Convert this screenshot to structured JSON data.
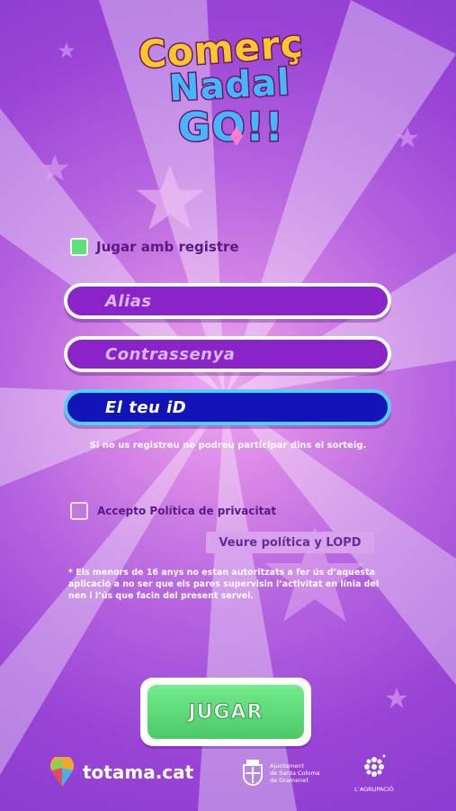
{
  "logo": {
    "line1": "Comerç",
    "line2": "Nadal",
    "line3": "GO!!"
  },
  "form": {
    "register_checkbox": {
      "label": "Jugar amb registre",
      "checked": true
    },
    "alias_field": {
      "placeholder": "Alias"
    },
    "password_field": {
      "placeholder": "Contrassenya"
    },
    "id_field": {
      "placeholder": "El teu iD"
    },
    "register_note": "Si no us registreu no podreu participar dins el sorteig.",
    "privacy_checkbox": {
      "label": "Accepto Política de privacitat",
      "checked": false
    },
    "policy_button": "Veure política y LOPD",
    "minors_note": "* Els menors de 16 anys no estan autoritzats a fer ús d’aquesta aplicació a no ser que els pares supervisin l’activitat en línia del nen i l’ús que facin del present servei."
  },
  "play_button": "JUGAR",
  "footer": {
    "brand": "totama.cat",
    "city_hall": [
      "Ajuntament",
      "de Santa Coloma",
      "de Gramenet"
    ],
    "association": "L’AGRUPACIÓ"
  },
  "colors": {
    "accent_green": "#5fe07a",
    "field_purple": "#8a24c8",
    "field_blue": "#1214b8",
    "background": "#b664e0"
  }
}
